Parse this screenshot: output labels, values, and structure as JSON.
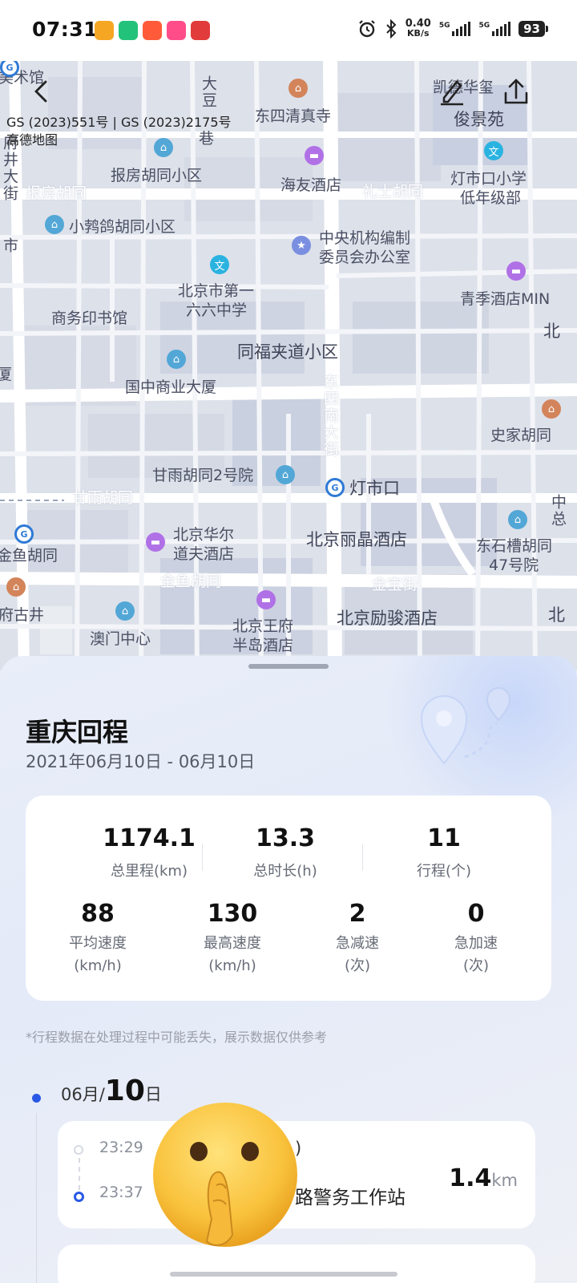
{
  "status_bar": {
    "time": "07:31",
    "net_speed_value": "0.40",
    "net_speed_unit": "KB/s",
    "sim1": "5G",
    "sim2": "5G",
    "battery": "93",
    "icons": [
      "alarm-icon",
      "bluetooth-icon"
    ]
  },
  "map": {
    "copyright_line1": "GS (2023)551号 | GS (2023)2175号",
    "copyright_line2": "高德地图",
    "labels": {
      "meishuguan": "美术馆",
      "dadou": "大豆",
      "xiang": "巷",
      "dongsi_mosque": "东四清真寺",
      "kaide": "凯德华玺",
      "junjing": "俊景苑",
      "baofang_res": "报房胡同小区",
      "haiyou": "海友酒店",
      "lishi": "礼士胡同",
      "dengshikou_school": "灯市口小学",
      "grade_low": "低年级部",
      "baofang_road": "报房胡同",
      "xiaojuge": "小鹁鸽胡同小区",
      "central_org_1": "中央机构编制",
      "central_org_2": "委员会办公室",
      "qingji": "青季酒店MIN",
      "no166_1": "北京市第一",
      "no166_2": "六六中学",
      "commercial_press": "商务印书馆",
      "tongfujia": "同福夹道小区",
      "guozhong": "国中商业大厦",
      "dongsi_south": "东四南大街",
      "shijia": "史家胡同",
      "ganyu2": "甘雨胡同2号院",
      "dengshikou": "灯市口",
      "ganyu_road": "甘雨胡同",
      "huaer_1": "北京华尔",
      "huaer_2": "道夫酒店",
      "lijing": "北京丽晶酒店",
      "dongshicao_1": "东石槽胡同",
      "dongshicao_2": "47号院",
      "jinyu_left": "金鱼胡同",
      "jinyu_road": "金鱼胡同",
      "jinbao": "金宝街",
      "fuguji": "府古井",
      "macau_center": "澳门中心",
      "peninsula_1": "北京王府",
      "peninsula_2": "半岛酒店",
      "lijun": "北京励骏酒店",
      "xiasha": "厦",
      "fujing": "府井大街",
      "bei": "北",
      "bei2": "北",
      "zhong": "中总",
      "shi": "市"
    }
  },
  "trip": {
    "title": "重庆回程",
    "date_range": "2021年06月10日  - 06月10日",
    "stats": [
      {
        "value": "1174.1",
        "label": "总里程(km)"
      },
      {
        "value": "13.3",
        "label": "总时长(h)"
      },
      {
        "value": "11",
        "label": "行程(个)"
      }
    ],
    "stats2": [
      {
        "value": "88",
        "label1": "平均速度",
        "label2": "(km/h)"
      },
      {
        "value": "130",
        "label1": "最高速度",
        "label2": "(km/h)"
      },
      {
        "value": "2",
        "label1": "急减速",
        "label2": "(次)"
      },
      {
        "value": "0",
        "label1": "急加速",
        "label2": "(次)"
      }
    ],
    "note": "*行程数据在处理过程中可能丢失，展示数据仅供参考",
    "day_month": "06月/",
    "day_num": "10",
    "day_suffix": "日",
    "segments": [
      {
        "start_time": "23:29",
        "start_place": ")",
        "end_time": "23:37",
        "end_place": "路警务工作站",
        "distance": "1.4",
        "distance_unit": "km"
      }
    ]
  }
}
